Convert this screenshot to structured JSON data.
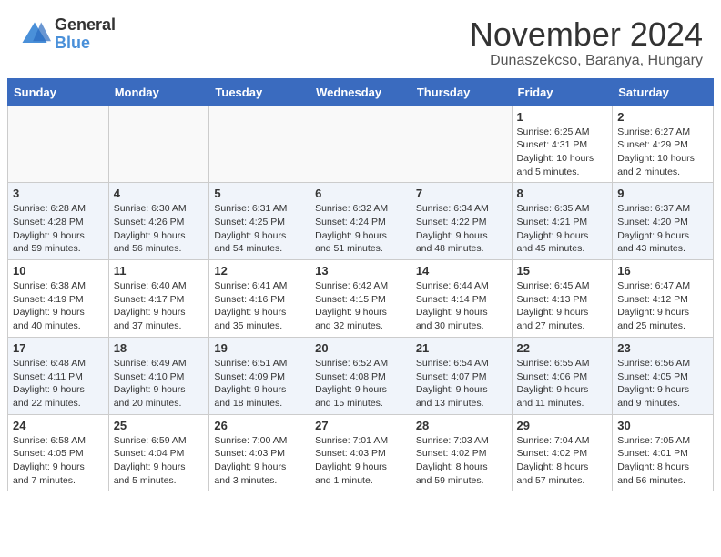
{
  "logo": {
    "general": "General",
    "blue": "Blue"
  },
  "title": "November 2024",
  "location": "Dunaszekcso, Baranya, Hungary",
  "days_of_week": [
    "Sunday",
    "Monday",
    "Tuesday",
    "Wednesday",
    "Thursday",
    "Friday",
    "Saturday"
  ],
  "weeks": [
    [
      {
        "day": "",
        "info": ""
      },
      {
        "day": "",
        "info": ""
      },
      {
        "day": "",
        "info": ""
      },
      {
        "day": "",
        "info": ""
      },
      {
        "day": "",
        "info": ""
      },
      {
        "day": "1",
        "info": "Sunrise: 6:25 AM\nSunset: 4:31 PM\nDaylight: 10 hours\nand 5 minutes."
      },
      {
        "day": "2",
        "info": "Sunrise: 6:27 AM\nSunset: 4:29 PM\nDaylight: 10 hours\nand 2 minutes."
      }
    ],
    [
      {
        "day": "3",
        "info": "Sunrise: 6:28 AM\nSunset: 4:28 PM\nDaylight: 9 hours\nand 59 minutes."
      },
      {
        "day": "4",
        "info": "Sunrise: 6:30 AM\nSunset: 4:26 PM\nDaylight: 9 hours\nand 56 minutes."
      },
      {
        "day": "5",
        "info": "Sunrise: 6:31 AM\nSunset: 4:25 PM\nDaylight: 9 hours\nand 54 minutes."
      },
      {
        "day": "6",
        "info": "Sunrise: 6:32 AM\nSunset: 4:24 PM\nDaylight: 9 hours\nand 51 minutes."
      },
      {
        "day": "7",
        "info": "Sunrise: 6:34 AM\nSunset: 4:22 PM\nDaylight: 9 hours\nand 48 minutes."
      },
      {
        "day": "8",
        "info": "Sunrise: 6:35 AM\nSunset: 4:21 PM\nDaylight: 9 hours\nand 45 minutes."
      },
      {
        "day": "9",
        "info": "Sunrise: 6:37 AM\nSunset: 4:20 PM\nDaylight: 9 hours\nand 43 minutes."
      }
    ],
    [
      {
        "day": "10",
        "info": "Sunrise: 6:38 AM\nSunset: 4:19 PM\nDaylight: 9 hours\nand 40 minutes."
      },
      {
        "day": "11",
        "info": "Sunrise: 6:40 AM\nSunset: 4:17 PM\nDaylight: 9 hours\nand 37 minutes."
      },
      {
        "day": "12",
        "info": "Sunrise: 6:41 AM\nSunset: 4:16 PM\nDaylight: 9 hours\nand 35 minutes."
      },
      {
        "day": "13",
        "info": "Sunrise: 6:42 AM\nSunset: 4:15 PM\nDaylight: 9 hours\nand 32 minutes."
      },
      {
        "day": "14",
        "info": "Sunrise: 6:44 AM\nSunset: 4:14 PM\nDaylight: 9 hours\nand 30 minutes."
      },
      {
        "day": "15",
        "info": "Sunrise: 6:45 AM\nSunset: 4:13 PM\nDaylight: 9 hours\nand 27 minutes."
      },
      {
        "day": "16",
        "info": "Sunrise: 6:47 AM\nSunset: 4:12 PM\nDaylight: 9 hours\nand 25 minutes."
      }
    ],
    [
      {
        "day": "17",
        "info": "Sunrise: 6:48 AM\nSunset: 4:11 PM\nDaylight: 9 hours\nand 22 minutes."
      },
      {
        "day": "18",
        "info": "Sunrise: 6:49 AM\nSunset: 4:10 PM\nDaylight: 9 hours\nand 20 minutes."
      },
      {
        "day": "19",
        "info": "Sunrise: 6:51 AM\nSunset: 4:09 PM\nDaylight: 9 hours\nand 18 minutes."
      },
      {
        "day": "20",
        "info": "Sunrise: 6:52 AM\nSunset: 4:08 PM\nDaylight: 9 hours\nand 15 minutes."
      },
      {
        "day": "21",
        "info": "Sunrise: 6:54 AM\nSunset: 4:07 PM\nDaylight: 9 hours\nand 13 minutes."
      },
      {
        "day": "22",
        "info": "Sunrise: 6:55 AM\nSunset: 4:06 PM\nDaylight: 9 hours\nand 11 minutes."
      },
      {
        "day": "23",
        "info": "Sunrise: 6:56 AM\nSunset: 4:05 PM\nDaylight: 9 hours\nand 9 minutes."
      }
    ],
    [
      {
        "day": "24",
        "info": "Sunrise: 6:58 AM\nSunset: 4:05 PM\nDaylight: 9 hours\nand 7 minutes."
      },
      {
        "day": "25",
        "info": "Sunrise: 6:59 AM\nSunset: 4:04 PM\nDaylight: 9 hours\nand 5 minutes."
      },
      {
        "day": "26",
        "info": "Sunrise: 7:00 AM\nSunset: 4:03 PM\nDaylight: 9 hours\nand 3 minutes."
      },
      {
        "day": "27",
        "info": "Sunrise: 7:01 AM\nSunset: 4:03 PM\nDaylight: 9 hours\nand 1 minute."
      },
      {
        "day": "28",
        "info": "Sunrise: 7:03 AM\nSunset: 4:02 PM\nDaylight: 8 hours\nand 59 minutes."
      },
      {
        "day": "29",
        "info": "Sunrise: 7:04 AM\nSunset: 4:02 PM\nDaylight: 8 hours\nand 57 minutes."
      },
      {
        "day": "30",
        "info": "Sunrise: 7:05 AM\nSunset: 4:01 PM\nDaylight: 8 hours\nand 56 minutes."
      }
    ]
  ]
}
